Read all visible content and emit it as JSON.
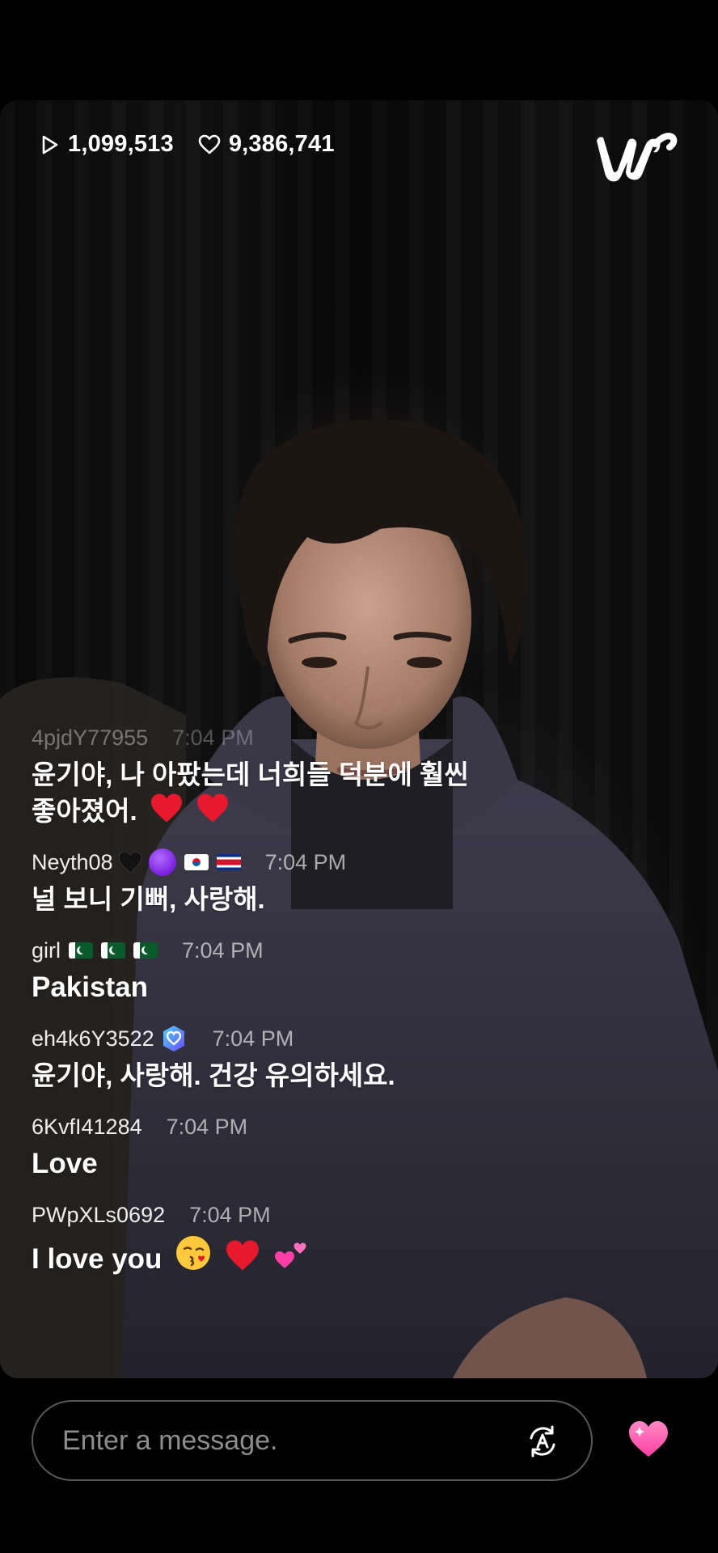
{
  "stats": {
    "views": "1,099,513",
    "likes": "9,386,741",
    "views_icon": "play-icon",
    "likes_icon": "heart-outline-icon"
  },
  "brand": {
    "logo": "weverse-w-logo"
  },
  "chat": [
    {
      "user": "4pjdY77955",
      "time": "7:04 PM",
      "faded": true,
      "text_line1": "윤기야, 나 아팠는데 너희들 덕분에 훨씬",
      "text_line2": "좋아졌어.",
      "emojis": [
        "red-heart",
        "red-heart"
      ]
    },
    {
      "user": "Neyth08",
      "time": "7:04 PM",
      "decorations": [
        "black-heart",
        "purple-circle",
        "flag-south-korea",
        "flag-costa-rica"
      ],
      "text": "널 보니 기뻐, 사랑해."
    },
    {
      "user": "girl",
      "time": "7:04 PM",
      "decorations": [
        "flag-pakistan",
        "flag-pakistan",
        "flag-pakistan"
      ],
      "text": "Pakistan"
    },
    {
      "user": "eh4k6Y3522",
      "time": "7:04 PM",
      "decorations": [
        "membership-badge"
      ],
      "text": "윤기야, 사랑해. 건강 유의하세요."
    },
    {
      "user": "6KvfI41284",
      "time": "7:04 PM",
      "text": "Love"
    },
    {
      "user": "PWpXLs0692",
      "time": "7:04 PM",
      "text": "I love you",
      "emojis": [
        "kissing-face",
        "red-heart",
        "two-hearts"
      ]
    }
  ],
  "composer": {
    "placeholder": "Enter a message.",
    "translate_icon": "translate-icon",
    "like_icon": "pink-heart-icon"
  },
  "colors": {
    "background": "#000000",
    "heart_red": "#e8182d",
    "heart_pink": "#ff5fb0",
    "purple": "#8a2be2"
  }
}
